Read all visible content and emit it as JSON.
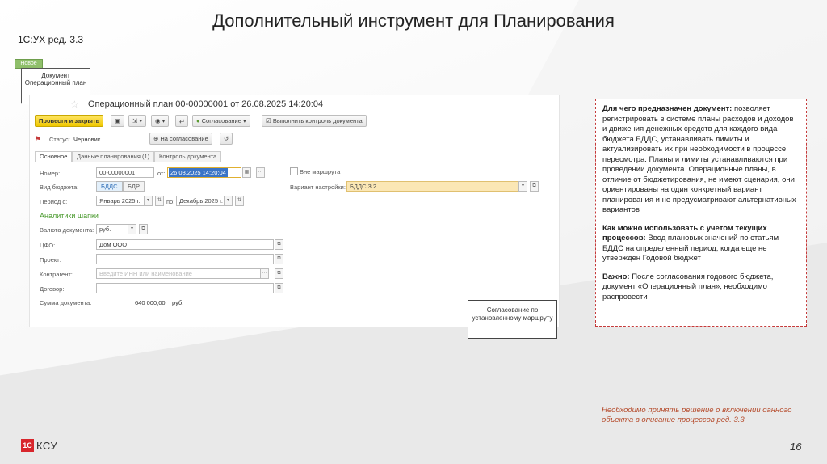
{
  "slide": {
    "title": "Дополнительный инструмент для Планирования",
    "subtitle": "1С:УХ ред. 3.3",
    "page_number": "16",
    "logo_mark": "1С",
    "logo_text": "КСУ",
    "note": "Необходимо принять решение о включении данного объекта в описание процессов ред. 3.3"
  },
  "flowchart": {
    "new_tag": "Новое",
    "doc_label": "Документ Операционный план",
    "route_label": "Согласование по установленному маршруту"
  },
  "window": {
    "title": "Операционный план 00-00000001 от 26.08.2025 14:20:04",
    "toolbar": {
      "post_close": "Провести и закрыть",
      "approval": "Согласование",
      "run_check": "Выполнить контроль документа"
    },
    "status_label": "Статус:",
    "status_value": "Черновик",
    "to_approval": "На согласование",
    "tabs": [
      "Основное",
      "Данные планирования (1)",
      "Контроль документа"
    ],
    "labels": {
      "number": "Номер:",
      "from": "от:",
      "budget_type": "Вид бюджета:",
      "period_from": "Период с:",
      "period_to": "по:",
      "header_analytics": "Аналитики шапки",
      "currency": "Валюта документа:",
      "cfo": "ЦФО:",
      "project": "Проект:",
      "counterparty": "Контрагент:",
      "contract": "Договор:",
      "sum": "Сумма документа:",
      "outside_route": "Вне маршрута",
      "settings_variant": "Вариант настройки:"
    },
    "values": {
      "number": "00-00000001",
      "date": "26.08.2025 14:20:04",
      "budget_bdds": "БДДС",
      "budget_bdr": "БДР",
      "period_from": "Январь 2025 г.",
      "period_to": "Декабрь 2025 г.",
      "currency": "руб.",
      "cfo": "Дом ООО",
      "counterparty_placeholder": "Введите ИНН или наименование",
      "sum": "640 000,00",
      "sum_currency": "руб.",
      "settings_variant": "БДДС 3.2"
    }
  },
  "info": {
    "p1_bold": "Для чего предназначен документ:",
    "p1_text": " позволяет регистрировать в системе планы расходов и доходов и движения денежных средств для каждого вида бюджета БДДС, устанавливать лимиты и актуализировать их при необходимости в процессе пересмотра. Планы и лимиты устанавливаются при проведении документа. Операционные планы, в отличие от бюджетирования, не имеют сценария, они ориентированы на один конкретный вариант планирования и не предусматривают альтернативных вариантов",
    "p2_bold": "Как можно использовать с учетом текущих процессов:",
    "p2_text": " Ввод плановых значений по статьям БДДС на определенный период, когда еще не утвержден Годовой бюджет",
    "p3_bold": "Важно:",
    "p3_text": " После согласования годового бюджета, документ «Операционный план», необходимо распровести"
  },
  "colors": {
    "accent_red": "#c53a3a",
    "brand_red": "#d8262c",
    "green": "#4a9a2e",
    "yellow": "#f0c800"
  }
}
